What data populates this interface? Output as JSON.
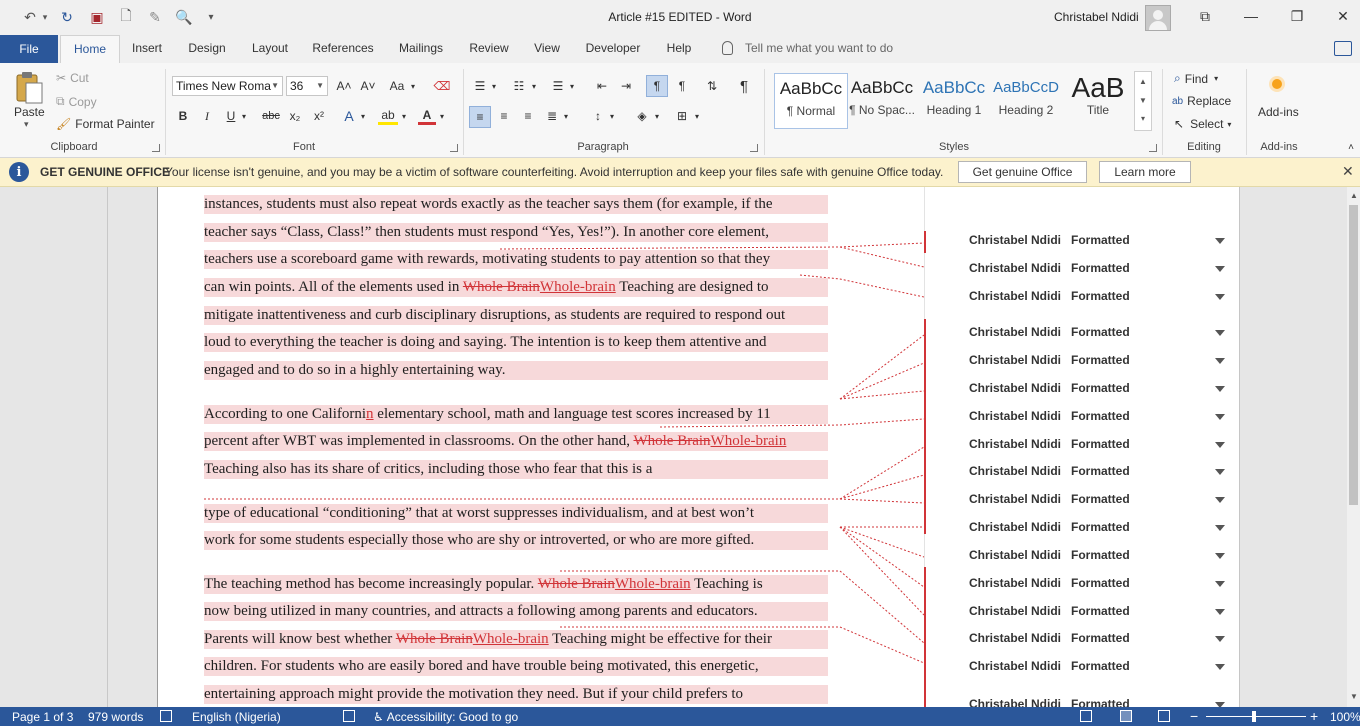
{
  "window": {
    "title": "Article #15 EDITED  -  Word",
    "user": "Christabel Ndidi",
    "controls": {
      "ribbon_display": "⧉",
      "minimize": "—",
      "restore": "❐",
      "close": "✕"
    }
  },
  "quick_access": {
    "undo": "↶",
    "redo": "↻",
    "save": "▣",
    "new": "🗋",
    "touch": "✎",
    "print_preview": "🔍",
    "customize": "▾"
  },
  "tabs": [
    "File",
    "Home",
    "Insert",
    "Design",
    "Layout",
    "References",
    "Mailings",
    "Review",
    "View",
    "Developer",
    "Help"
  ],
  "active_tab": "Home",
  "tell_me_placeholder": "Tell me what you want to do",
  "ribbon": {
    "clipboard": {
      "label": "Clipboard",
      "paste": "Paste",
      "cut": "Cut",
      "copy": "Copy",
      "format_painter": "Format Painter"
    },
    "font": {
      "label": "Font",
      "font_name": "Times New Roma",
      "font_size": "36",
      "bold": "B",
      "italic": "I",
      "underline": "U",
      "strike": "abc",
      "sub": "x₂",
      "sup": "x²",
      "grow": "A˄",
      "shrink": "A˅",
      "case": "Aa",
      "text_effects": "A",
      "highlight": "ab",
      "font_color": "A"
    },
    "paragraph": {
      "label": "Paragraph"
    },
    "styles": {
      "label": "Styles",
      "items": [
        {
          "preview": "AaBbCc",
          "name": "¶ Normal"
        },
        {
          "preview": "AaBbCc",
          "name": "¶ No Spac..."
        },
        {
          "preview": "AaBbCc",
          "name": "Heading 1"
        },
        {
          "preview": "AaBbCcD",
          "name": "Heading 2"
        },
        {
          "preview": "AaB",
          "name": "Title"
        }
      ]
    },
    "editing": {
      "label": "Editing",
      "find": "Find",
      "replace": "Replace",
      "select": "Select"
    },
    "addins": {
      "label": "Add-ins",
      "button": "Add-ins"
    }
  },
  "infobar": {
    "title": "GET GENUINE OFFICE",
    "message": "Your license isn't genuine, and you may be a victim of software counterfeiting. Avoid interruption and keep your files safe with genuine Office today.",
    "primary_button": "Get genuine Office",
    "secondary_button": "Learn more"
  },
  "document": {
    "lines": [
      [
        "instances, students must also repeat words exactly as the teacher says them (for example, if the"
      ],
      [
        "teacher says “Class, Class!” then students must respond “Yes, Yes!”). In another core element,"
      ],
      [
        "teachers use a scoreboard game with rewards, motivating students to pay attention so that they"
      ],
      [
        "can win points. All of the elements used in ",
        "Whole Brain",
        "Whole-brain",
        " Teaching are designed to"
      ],
      [
        "mitigate inattentiveness and curb disciplinary disruptions, as students are required to respond out"
      ],
      [
        "loud to everything the teacher is doing and saying. The intention is to keep them attentive and"
      ],
      [
        "engaged and to do so in a highly entertaining way."
      ],
      [
        "According to one Californi",
        "",
        "n",
        " elementary school, math and language test scores increased by 11"
      ],
      [
        "percent after WBT was implemented in classrooms. On the other hand, ",
        "Whole Brain",
        "Whole-brain",
        ""
      ],
      [
        "Teaching also has its share of critics, including those who fear that this is a"
      ],
      [
        "type of educational “conditioning” that at worst suppresses individualism, and at best won’t"
      ],
      [
        "work for some students especially those who are shy or introverted, or who are more gifted."
      ],
      [
        "The teaching method has become increasingly popular. ",
        "Whole Brain",
        "Whole-brain",
        " Teaching is"
      ],
      [
        "now being utilized in many countries, and attracts a following among parents and educators."
      ],
      [
        "Parents will know best whether ",
        "Whole Brain",
        "Whole-brain",
        " Teaching might be effective for their"
      ],
      [
        "children. For students who are easily bored and have trouble being motivated, this energetic,"
      ],
      [
        "entertaining approach might provide the motivation they need. But if your child prefers to"
      ]
    ],
    "balloons": [
      {
        "author": "Christabel Ndidi",
        "action": "Formatted"
      },
      {
        "author": "Christabel Ndidi",
        "action": "Formatted"
      },
      {
        "author": "Christabel Ndidi",
        "action": "Formatted"
      },
      {
        "author": "Christabel Ndidi",
        "action": "Formatted"
      },
      {
        "author": "Christabel Ndidi",
        "action": "Formatted"
      },
      {
        "author": "Christabel Ndidi",
        "action": "Formatted"
      },
      {
        "author": "Christabel Ndidi",
        "action": "Formatted"
      },
      {
        "author": "Christabel Ndidi",
        "action": "Formatted"
      },
      {
        "author": "Christabel Ndidi",
        "action": "Formatted"
      },
      {
        "author": "Christabel Ndidi",
        "action": "Formatted"
      },
      {
        "author": "Christabel Ndidi",
        "action": "Formatted"
      },
      {
        "author": "Christabel Ndidi",
        "action": "Formatted"
      },
      {
        "author": "Christabel Ndidi",
        "action": "Formatted"
      },
      {
        "author": "Christabel Ndidi",
        "action": "Formatted"
      },
      {
        "author": "Christabel Ndidi",
        "action": "Formatted"
      },
      {
        "author": "Christabel Ndidi",
        "action": "Formatted"
      },
      {
        "author": "Christabel Ndidi",
        "action": "Formatted"
      }
    ]
  },
  "statusbar": {
    "page": "Page 1 of 3",
    "words": "979 words",
    "language": "English (Nigeria)",
    "accessibility": "Accessibility: Good to go",
    "zoom": "100%",
    "zoom_minus": "−",
    "zoom_plus": "+"
  },
  "colors": {
    "accent": "#2b579a",
    "revision": "#d13438",
    "highlight": "#f7d9da",
    "infobar": "#fcf2cd"
  }
}
